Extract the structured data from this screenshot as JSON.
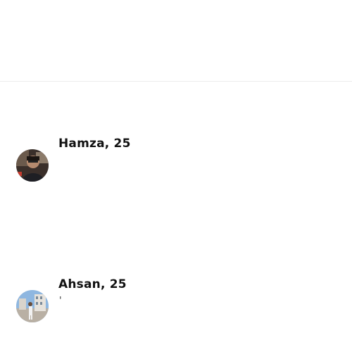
{
  "matches": [
    {
      "name": "Hamza, 25",
      "preview": "",
      "avatar_icon": "profile-photo-hamza"
    },
    {
      "name": "Ahsan, 25",
      "preview": "'",
      "avatar_icon": "profile-photo-ahsan"
    }
  ],
  "colors": {
    "background": "#ffffff",
    "divider": "#ececec",
    "text": "#111111"
  }
}
